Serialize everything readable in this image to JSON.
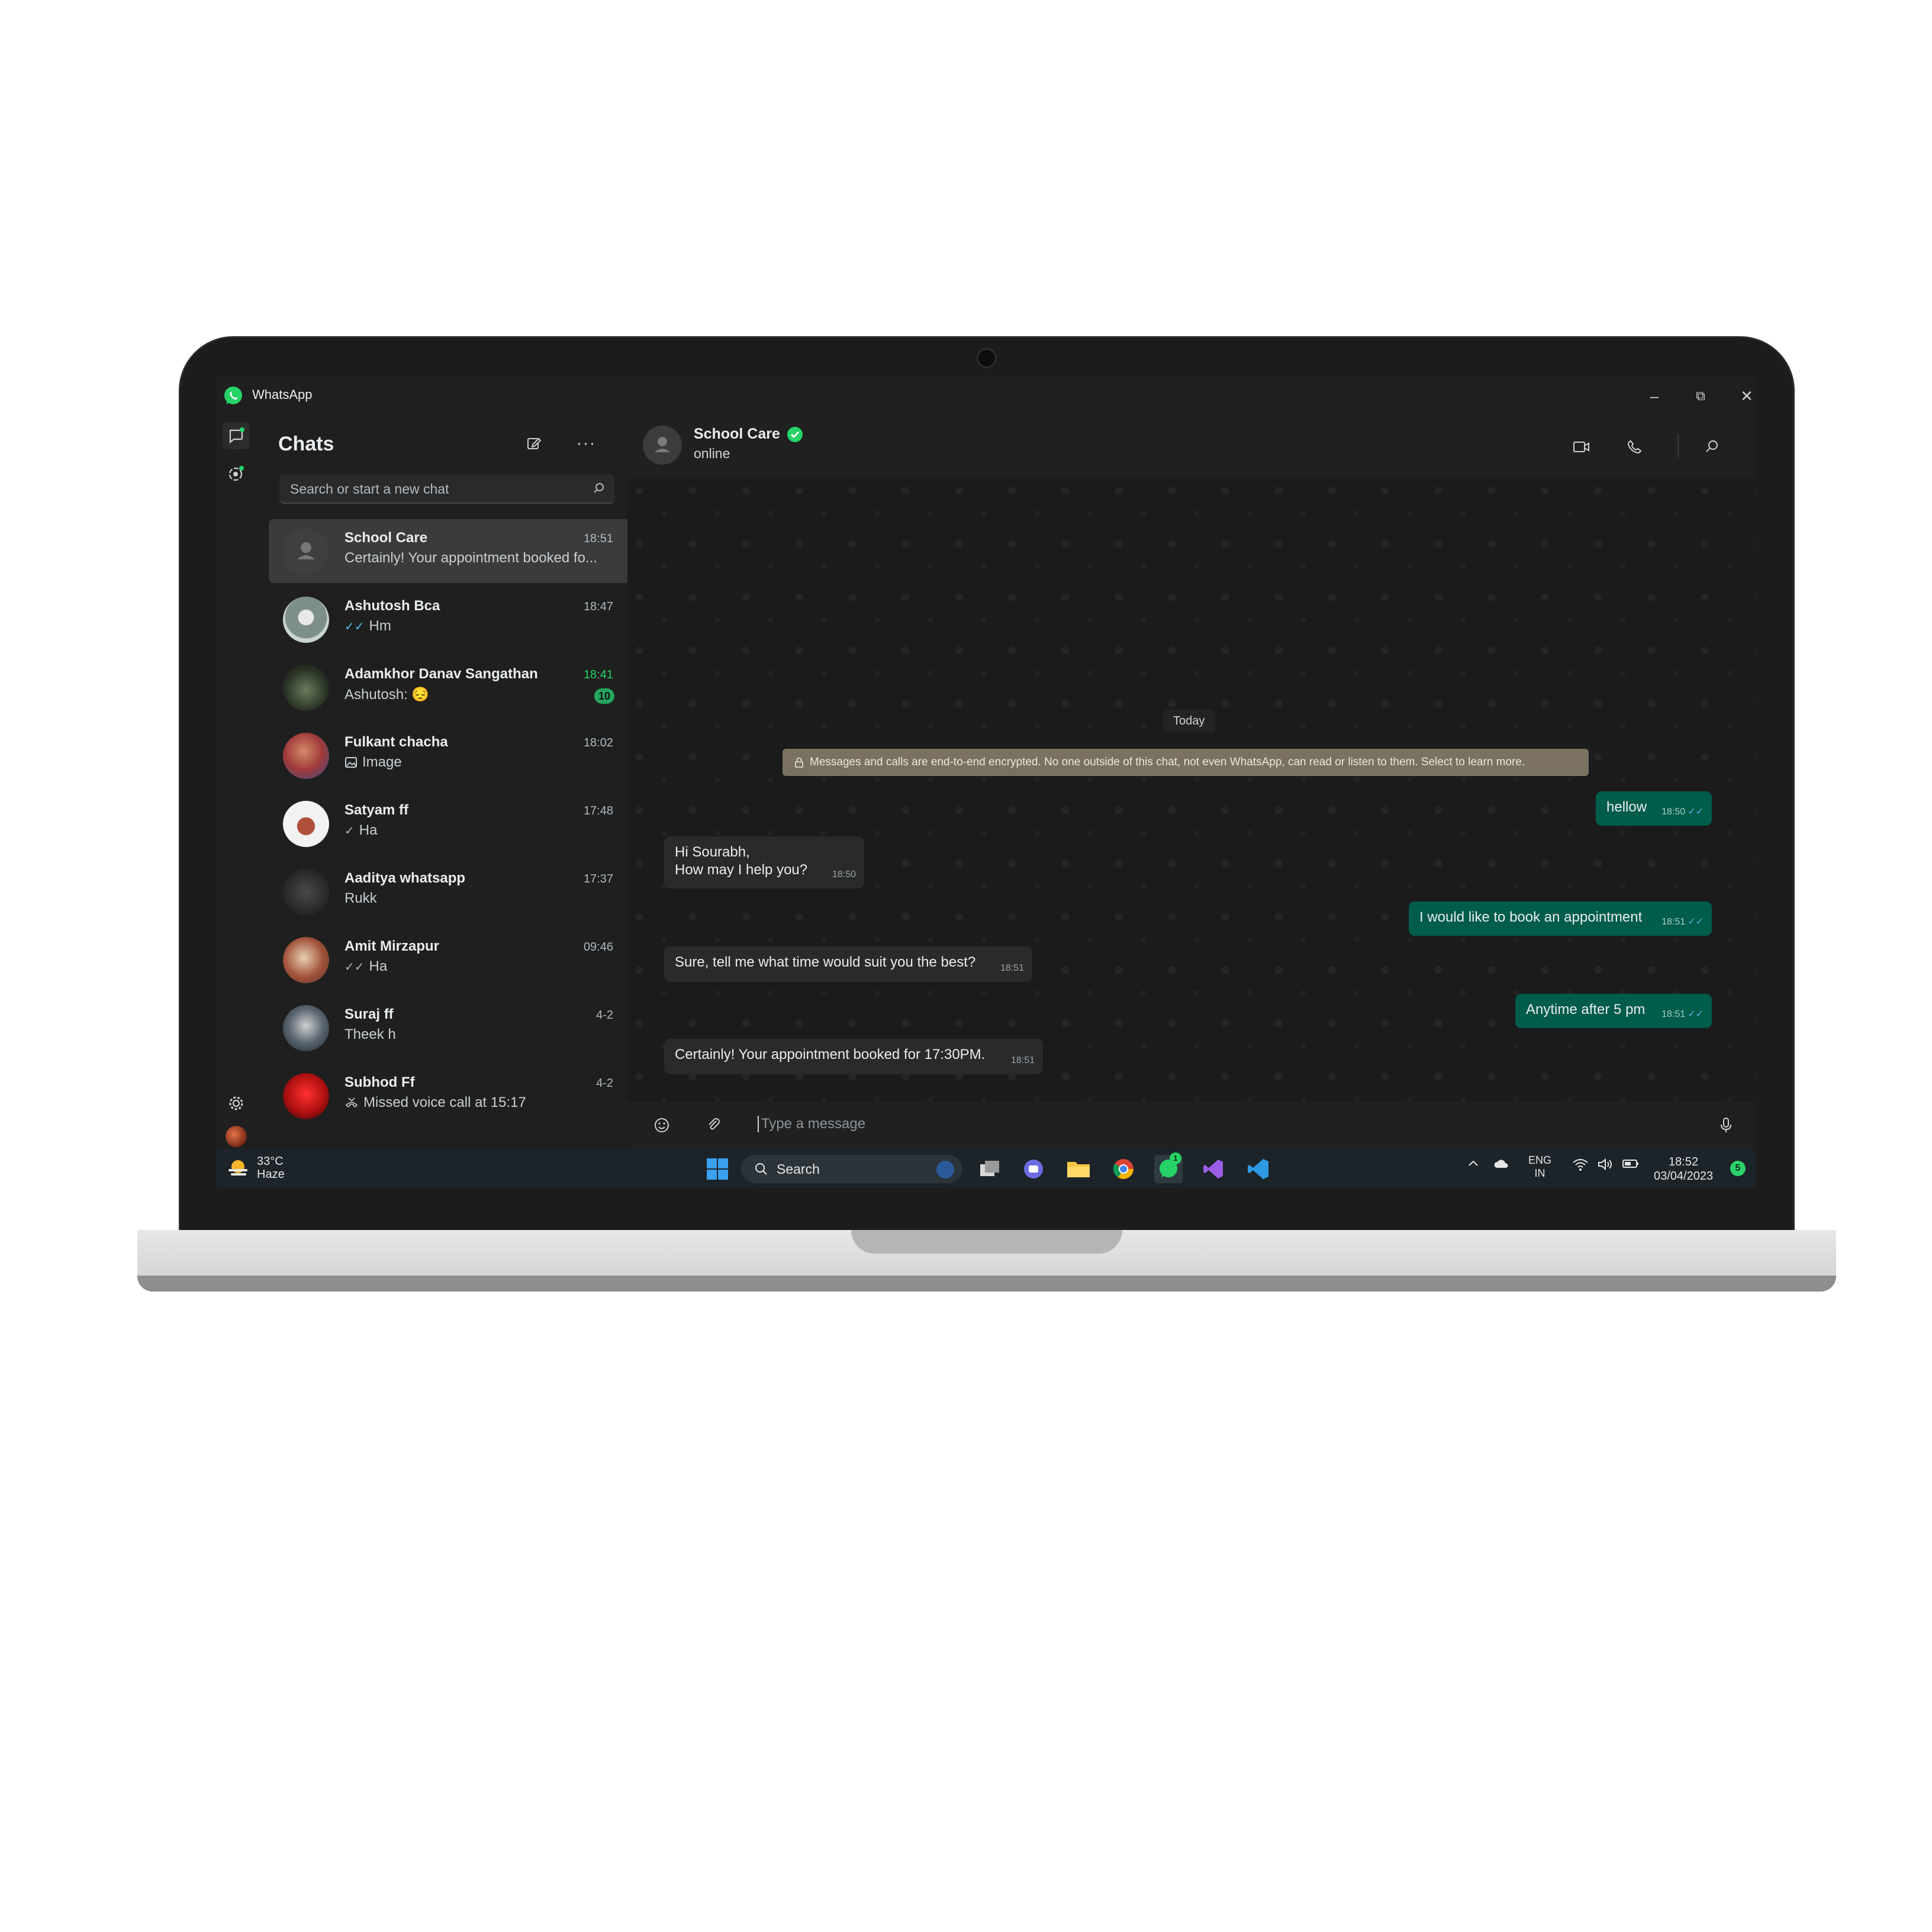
{
  "window": {
    "title": "WhatsApp",
    "controls": [
      "minimize",
      "restore",
      "close"
    ]
  },
  "chat_list": {
    "title": "Chats",
    "search_placeholder": "Search or start a new chat",
    "items": [
      {
        "name": "School Care",
        "time": "18:51",
        "preview": "Certainly! Your appointment booked fo...",
        "status_icon": "",
        "selected": true
      },
      {
        "name": "Ashutosh Bca",
        "time": "18:47",
        "preview": "Hm",
        "status_icon": "double-check-blue"
      },
      {
        "name": "Adamkhor Danav Sangathan",
        "time": "18:41",
        "preview": "Ashutosh: 😔",
        "status_icon": "",
        "unread": "10"
      },
      {
        "name": "Fulkant chacha",
        "time": "18:02",
        "preview": "Image",
        "status_icon": "image-icon"
      },
      {
        "name": "Satyam ff",
        "time": "17:48",
        "preview": "Ha",
        "status_icon": "single-check"
      },
      {
        "name": "Aaditya whatsapp",
        "time": "17:37",
        "preview": "Rukk",
        "status_icon": ""
      },
      {
        "name": "Amit Mirzapur",
        "time": "09:46",
        "preview": "Ha",
        "status_icon": "double-check-grey"
      },
      {
        "name": "Suraj ff",
        "time": "4-2",
        "preview": "Theek h",
        "status_icon": ""
      },
      {
        "name": "Subhod Ff",
        "time": "4-2",
        "preview": "Missed voice call at 15:17",
        "status_icon": "missed-call-icon"
      }
    ]
  },
  "conversation": {
    "contact_name": "School Care",
    "verified": true,
    "status": "online",
    "day_label": "Today",
    "encryption_notice": "Messages and calls are end-to-end encrypted. No one outside of this chat, not even WhatsApp, can read or listen to them. Select to learn more.",
    "messages": [
      {
        "dir": "out",
        "text": "hellow",
        "time": "18:50"
      },
      {
        "dir": "in",
        "line1": "Hi Sourabh,",
        "line2": "How may I help you?",
        "time": "18:50"
      },
      {
        "dir": "out",
        "text": "I would like to book an appointment",
        "time": "18:51"
      },
      {
        "dir": "in",
        "text": "Sure, tell me what time would suit you the best?",
        "time": "18:51"
      },
      {
        "dir": "out",
        "text": "Anytime after 5 pm",
        "time": "18:51"
      },
      {
        "dir": "in",
        "text": "Certainly! Your appointment booked for 17:30PM.",
        "time": "18:51"
      }
    ],
    "composer_placeholder": "Type a message"
  },
  "taskbar": {
    "weather_temp": "33°C",
    "weather_desc": "Haze",
    "search_label": "Search",
    "tray_lang1": "ENG",
    "tray_lang2": "IN",
    "time": "18:52",
    "date": "03/04/2023",
    "notification_count": "5",
    "whatsapp_badge": "1"
  },
  "colors": {
    "accent_green": "#25d366",
    "outgoing_bubble": "#005c4b",
    "incoming_bubble": "#2a2a2a",
    "encryption_banner": "#7a7163"
  }
}
